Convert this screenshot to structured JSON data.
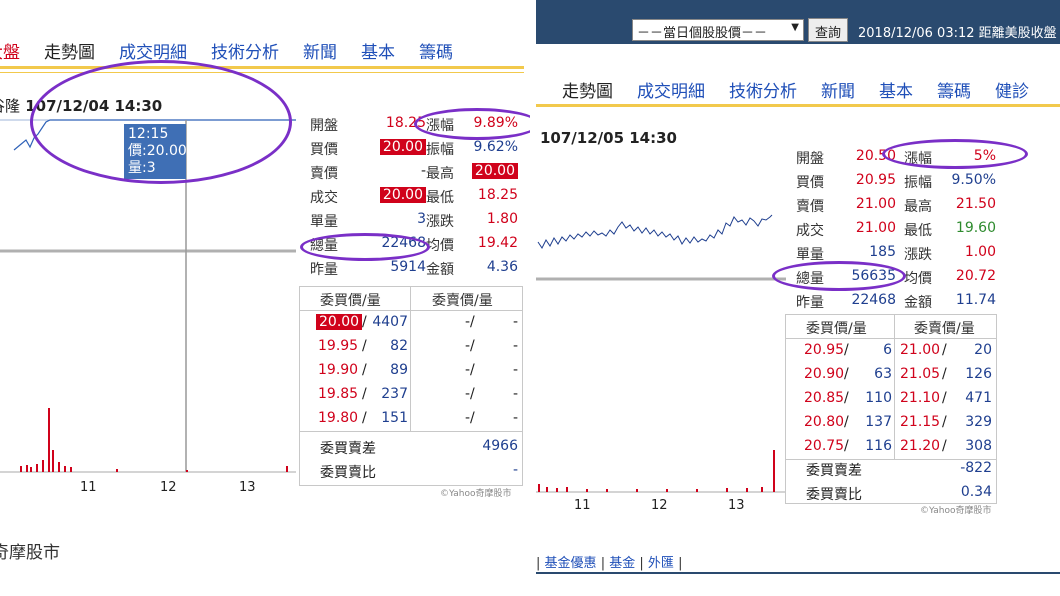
{
  "left": {
    "tabs": [
      {
        "label": "大盤",
        "state": "red-cut"
      },
      {
        "label": "走勢圖",
        "state": "current"
      },
      {
        "label": "成交明細",
        "state": "link"
      },
      {
        "label": "技術分析",
        "state": "link"
      },
      {
        "label": "新聞",
        "state": "link"
      },
      {
        "label": "基本",
        "state": "link"
      },
      {
        "label": "籌碼",
        "state": "link"
      }
    ],
    "stock_prefix": "谷隆",
    "timestamp": "107/12/04 14:30",
    "tooltip": {
      "time": "12:15",
      "price": "價:20.00",
      "volume": "量:3"
    },
    "quote": {
      "rows": [
        {
          "label1": "開盤",
          "value1": "18.25",
          "label2": "漲幅",
          "value2": "9.89%"
        },
        {
          "label1": "買價",
          "value1": "20.00",
          "label2": "振幅",
          "value2": "9.62%"
        },
        {
          "label1": "賣價",
          "value1": "-",
          "label2": "最高",
          "value2": "20.00"
        },
        {
          "label1": "成交",
          "value1": "20.00",
          "label2": "最低",
          "value2": "18.25"
        },
        {
          "label1": "單量",
          "value1": "3",
          "label2": "漲跌",
          "value2": "1.80"
        },
        {
          "label1": "總量",
          "value1": "22468",
          "label2": "均價",
          "value2": "19.42"
        },
        {
          "label1": "昨量",
          "value1": "5914",
          "label2": "金額",
          "value2": "4.36"
        }
      ]
    },
    "book": {
      "bid_header": "委買價/量",
      "ask_header": "委賣價/量",
      "rows": [
        {
          "bid_price": "20.00",
          "bid_vol": "4407",
          "ask_price": "-",
          "ask_vol": "-"
        },
        {
          "bid_price": "19.95",
          "bid_vol": "82",
          "ask_price": "-",
          "ask_vol": "-"
        },
        {
          "bid_price": "19.90",
          "bid_vol": "89",
          "ask_price": "-",
          "ask_vol": "-"
        },
        {
          "bid_price": "19.85",
          "bid_vol": "237",
          "ask_price": "-",
          "ask_vol": "-"
        },
        {
          "bid_price": "19.80",
          "bid_vol": "151",
          "ask_price": "-",
          "ask_vol": "-"
        }
      ],
      "diff_label": "委買賣差",
      "diff_value": "4966",
      "ratio_label": "委買賣比",
      "ratio_value": "-"
    },
    "x_ticks": [
      "11",
      "12",
      "13"
    ],
    "copyright": "©Yahoo奇摩股市",
    "footer": "奇摩股市"
  },
  "right": {
    "top": {
      "select_value": "－－當日個股股價－－",
      "query_button": "查詢",
      "datetime_text": "2018/12/06 03:12 距離美股收盤"
    },
    "tabs": [
      {
        "label": "走勢圖",
        "state": "current"
      },
      {
        "label": "成交明細",
        "state": "link"
      },
      {
        "label": "技術分析",
        "state": "link"
      },
      {
        "label": "新聞",
        "state": "link"
      },
      {
        "label": "基本",
        "state": "link"
      },
      {
        "label": "籌碼",
        "state": "link"
      },
      {
        "label": "健診",
        "state": "link"
      }
    ],
    "timestamp": "107/12/05 14:30",
    "quote": {
      "rows": [
        {
          "label1": "開盤",
          "value1": "20.50",
          "label2": "漲幅",
          "value2": "5%"
        },
        {
          "label1": "買價",
          "value1": "20.95",
          "label2": "振幅",
          "value2": "9.50%"
        },
        {
          "label1": "賣價",
          "value1": "21.00",
          "label2": "最高",
          "value2": "21.50"
        },
        {
          "label1": "成交",
          "value1": "21.00",
          "label2": "最低",
          "value2": "19.60"
        },
        {
          "label1": "單量",
          "value1": "185",
          "label2": "漲跌",
          "value2": "1.00"
        },
        {
          "label1": "總量",
          "value1": "56635",
          "label2": "均價",
          "value2": "20.72"
        },
        {
          "label1": "昨量",
          "value1": "22468",
          "label2": "金額",
          "value2": "11.74"
        }
      ]
    },
    "book": {
      "bid_header": "委買價/量",
      "ask_header": "委賣價/量",
      "rows": [
        {
          "bid_price": "20.95",
          "bid_vol": "6",
          "ask_price": "21.00",
          "ask_vol": "20"
        },
        {
          "bid_price": "20.90",
          "bid_vol": "63",
          "ask_price": "21.05",
          "ask_vol": "126"
        },
        {
          "bid_price": "20.85",
          "bid_vol": "110",
          "ask_price": "21.10",
          "ask_vol": "471"
        },
        {
          "bid_price": "20.80",
          "bid_vol": "137",
          "ask_price": "21.15",
          "ask_vol": "329"
        },
        {
          "bid_price": "20.75",
          "bid_vol": "116",
          "ask_price": "21.20",
          "ask_vol": "308"
        }
      ],
      "diff_label": "委買賣差",
      "diff_value": "-822",
      "ratio_label": "委買賣比",
      "ratio_value": "0.34"
    },
    "x_ticks": [
      "11",
      "12",
      "13"
    ],
    "copyright": "©Yahoo奇摩股市",
    "footer_links": [
      "基金優惠",
      "基金",
      "外匯"
    ]
  },
  "colors": {
    "up": "#d0021b",
    "down": "#2e8b2e",
    "link": "#1f4fb8",
    "annotation": "#7a2fc7",
    "line": "#1f3f8f"
  }
}
